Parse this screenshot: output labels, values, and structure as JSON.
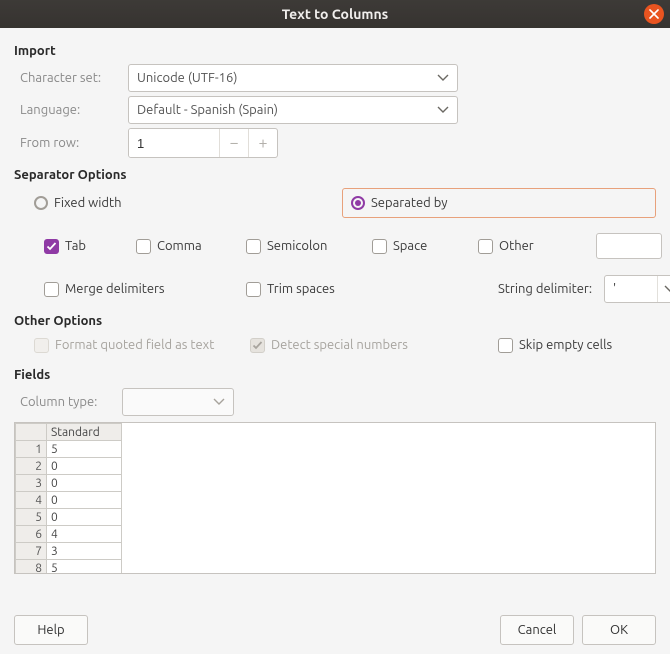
{
  "title": "Text to Columns",
  "import": {
    "heading": "Import",
    "charset_label": "Character set:",
    "charset_value": "Unicode (UTF-16)",
    "language_label": "Language:",
    "language_value": "Default - Spanish (Spain)",
    "fromrow_label": "From row:",
    "fromrow_value": "1"
  },
  "sep": {
    "heading": "Separator Options",
    "fixed_width": "Fixed width",
    "separated_by": "Separated by",
    "tab": "Tab",
    "comma": "Comma",
    "semicolon": "Semicolon",
    "space": "Space",
    "other": "Other",
    "merge": "Merge delimiters",
    "trim": "Trim spaces",
    "string_delim_label": "String delimiter:",
    "string_delim_value": "'"
  },
  "other": {
    "heading": "Other Options",
    "format_quoted": "Format quoted field as text",
    "detect_special": "Detect special numbers",
    "skip_empty": "Skip empty cells"
  },
  "fields": {
    "heading": "Fields",
    "coltype_label": "Column type:",
    "header": "Standard",
    "rows": [
      "5",
      "0",
      "0",
      "0",
      "0",
      "4",
      "3",
      "5"
    ]
  },
  "buttons": {
    "help": "Help",
    "cancel": "Cancel",
    "ok": "OK"
  }
}
